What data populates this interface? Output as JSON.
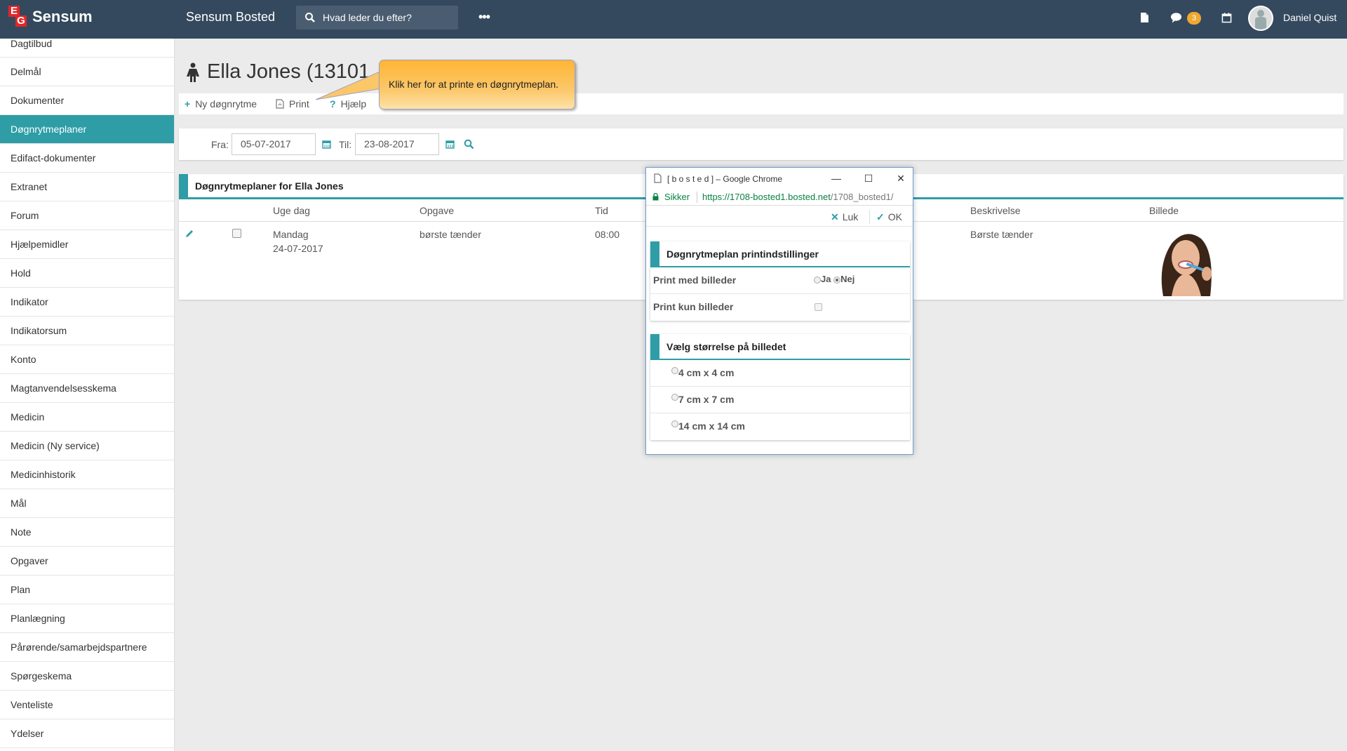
{
  "topbar": {
    "logo_e": "E",
    "logo_g": "G",
    "logo_text": "Sensum",
    "app_title": "Sensum Bosted",
    "search_placeholder": "Hvad leder du efter?",
    "more": "•••",
    "messages_badge": "3",
    "user_name": "Daniel Quist",
    "icons": [
      "search-icon",
      "more-icon",
      "document-icon",
      "chat-icon",
      "calendar-icon",
      "avatar"
    ]
  },
  "sidebar": {
    "items": [
      {
        "label": "Dagtilbud"
      },
      {
        "label": "Delmål"
      },
      {
        "label": "Dokumenter"
      },
      {
        "label": "Døgnrytmeplaner",
        "active": true
      },
      {
        "label": "Edifact-dokumenter"
      },
      {
        "label": "Extranet"
      },
      {
        "label": "Forum"
      },
      {
        "label": "Hjælpemidler"
      },
      {
        "label": "Hold"
      },
      {
        "label": "Indikator"
      },
      {
        "label": "Indikatorsum"
      },
      {
        "label": "Konto"
      },
      {
        "label": "Magtanvendelsesskema"
      },
      {
        "label": "Medicin"
      },
      {
        "label": "Medicin (Ny service)"
      },
      {
        "label": "Medicinhistorik"
      },
      {
        "label": "Mål"
      },
      {
        "label": "Note"
      },
      {
        "label": "Opgaver"
      },
      {
        "label": "Plan"
      },
      {
        "label": "Planlægning"
      },
      {
        "label": "Pårørende/samarbejdspartnere"
      },
      {
        "label": "Spørgeskema"
      },
      {
        "label": "Venteliste"
      },
      {
        "label": "Ydelser"
      }
    ]
  },
  "page": {
    "title": "Ella Jones (13101",
    "toolbar": {
      "new_label": "Ny døgnrytme",
      "print_label": "Print",
      "help_label": "Hjælp"
    },
    "callout": "Klik her for at printe en døgnrytmeplan."
  },
  "filter": {
    "from_label": "Fra:",
    "from_value": "05-07-2017",
    "to_label": "Til:",
    "to_value": "23-08-2017"
  },
  "table": {
    "heading": "Døgnrytmeplaner for  Ella Jones",
    "columns": {
      "weekday": "Uge dag",
      "task": "Opgave",
      "time": "Tid",
      "description": "Beskrivelse",
      "image": "Billede"
    },
    "rows": [
      {
        "weekday": "Mandag",
        "date": "24-07-2017",
        "task": "børste tænder",
        "time": "08:00",
        "description": "Børste tænder"
      }
    ]
  },
  "popup": {
    "window_title": "[ b o s t e d ] – Google Chrome",
    "secure_label": "Sikker",
    "url_host": "https://1708-bosted1.bosted.net",
    "url_path": "/1708_bosted1/",
    "close_label": "Luk",
    "ok_label": "OK",
    "section1": {
      "title": "Døgnrytmeplan printindstillinger",
      "print_images_label": "Print med billeder",
      "yes_label": "Ja",
      "no_label": "Nej",
      "print_images_value": "Nej",
      "print_only_images_label": "Print kun billeder",
      "print_only_images_checked": false
    },
    "section2": {
      "title": "Vælg størrelse på billedet",
      "options": [
        "4 cm x 4 cm",
        "7 cm x 7 cm",
        "14 cm x 14 cm"
      ]
    }
  },
  "colors": {
    "topbar": "#34495e",
    "accent": "#2e9da6",
    "callout": "#fbc769",
    "badge": "#f0a830"
  }
}
